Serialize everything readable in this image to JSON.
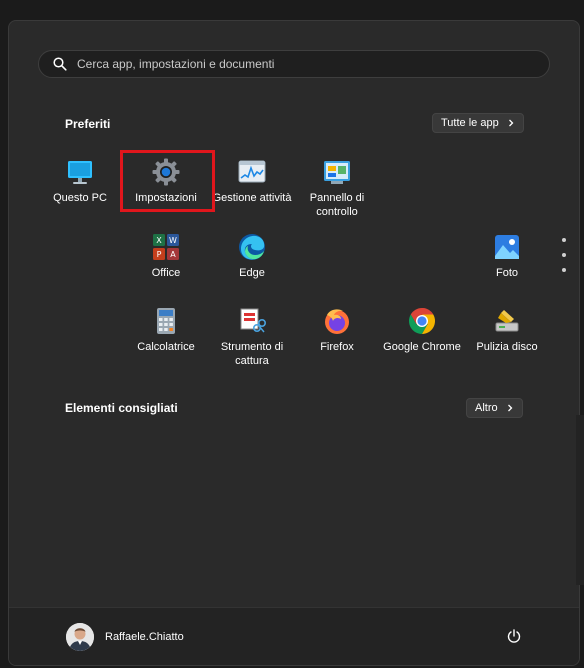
{
  "search": {
    "placeholder": "Cerca app, impostazioni e documenti",
    "icon": "search-icon"
  },
  "pinned": {
    "title": "Preferiti",
    "all_apps_label": "Tutte le app",
    "apps": [
      {
        "label": "Questo PC",
        "icon": "this-pc-icon"
      },
      {
        "label": "Impostazioni",
        "icon": "settings-gear-icon",
        "highlighted": true
      },
      {
        "label": "Gestione attività",
        "icon": "task-manager-icon"
      },
      {
        "label": "Pannello di controllo",
        "icon": "control-panel-icon"
      },
      {
        "label": "Office",
        "icon": "office-icon"
      },
      {
        "label": "Edge",
        "icon": "edge-icon"
      },
      {
        "label": "Foto",
        "icon": "photos-icon"
      },
      {
        "label": "Calcolatrice",
        "icon": "calculator-icon"
      },
      {
        "label": "Strumento di cattura",
        "icon": "snipping-tool-icon"
      },
      {
        "label": "Firefox",
        "icon": "firefox-icon"
      },
      {
        "label": "Google Chrome",
        "icon": "chrome-icon"
      },
      {
        "label": "Pulizia disco",
        "icon": "disk-cleanup-icon"
      }
    ]
  },
  "recommended": {
    "title": "Elementi consigliati",
    "more_label": "Altro"
  },
  "user": {
    "name": "Raffaele.Chiatto"
  },
  "colors": {
    "highlight": "#e0161c",
    "background": "#2a2a2a",
    "accent": "#0078d4"
  }
}
